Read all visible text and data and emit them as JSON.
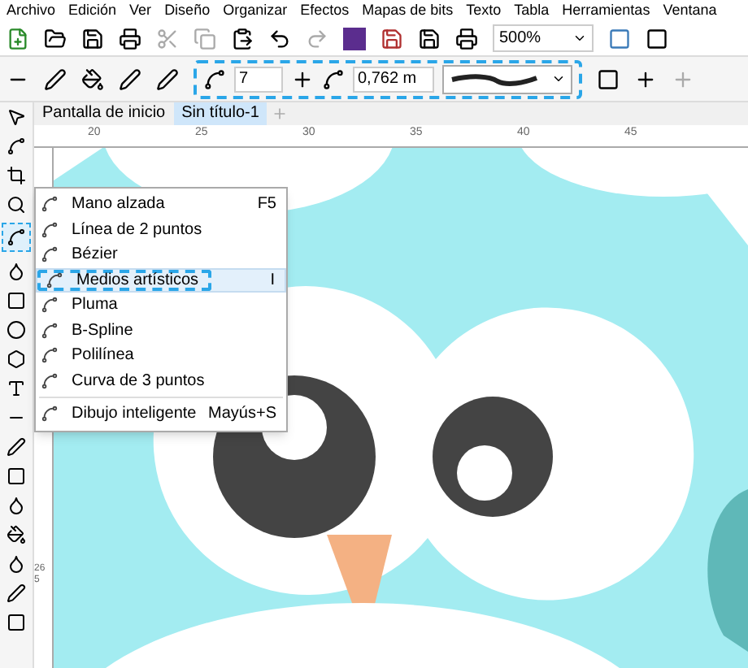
{
  "menu_bar": {
    "items": [
      "Archivo",
      "Edición",
      "Ver",
      "Diseño",
      "Organizar",
      "Efectos",
      "Mapas de bits",
      "Texto",
      "Tabla",
      "Herramientas",
      "Ventana"
    ]
  },
  "toolbar": {
    "zoom": "500%"
  },
  "property_bar": {
    "smoothing": "7",
    "width": "0,762 m"
  },
  "tabs": [
    {
      "label": "Pantalla de inicio",
      "selected": false
    },
    {
      "label": "Sin título-1",
      "selected": true
    }
  ],
  "ruler": {
    "horizontal": [
      "20",
      "25",
      "30",
      "35",
      "40",
      "45"
    ],
    "vertical": [
      "265"
    ]
  },
  "toolbox": [
    {
      "selected": false
    },
    {
      "selected": false
    },
    {
      "selected": false
    },
    {
      "selected": false
    },
    {
      "selected": true
    },
    {
      "selected": false
    },
    {
      "selected": false
    },
    {
      "selected": false
    },
    {
      "selected": false
    },
    {
      "selected": false
    },
    {
      "selected": false
    },
    {
      "selected": false
    },
    {
      "selected": false
    },
    {
      "selected": false
    },
    {
      "selected": false
    },
    {
      "selected": false
    },
    {
      "selected": false
    },
    {
      "selected": false
    }
  ],
  "flyout": [
    {
      "kind": "item",
      "label": "Mano alzada",
      "shortcut": "F5",
      "selected": false
    },
    {
      "kind": "item",
      "label": "Línea de 2 puntos",
      "selected": false
    },
    {
      "kind": "item",
      "label": "Bézier",
      "selected": false
    },
    {
      "kind": "item",
      "label": "Medios artísticos",
      "shortcut": "I",
      "selected": true
    },
    {
      "kind": "item",
      "label": "Pluma",
      "selected": false
    },
    {
      "kind": "item",
      "label": "B-Spline",
      "selected": false
    },
    {
      "kind": "item",
      "label": "Polilínea",
      "selected": false
    },
    {
      "kind": "item",
      "label": "Curva de 3 puntos",
      "selected": false
    },
    {
      "kind": "separator"
    },
    {
      "kind": "item",
      "label": "Dibujo inteligente",
      "shortcut": "Mayús+S",
      "selected": false
    }
  ]
}
